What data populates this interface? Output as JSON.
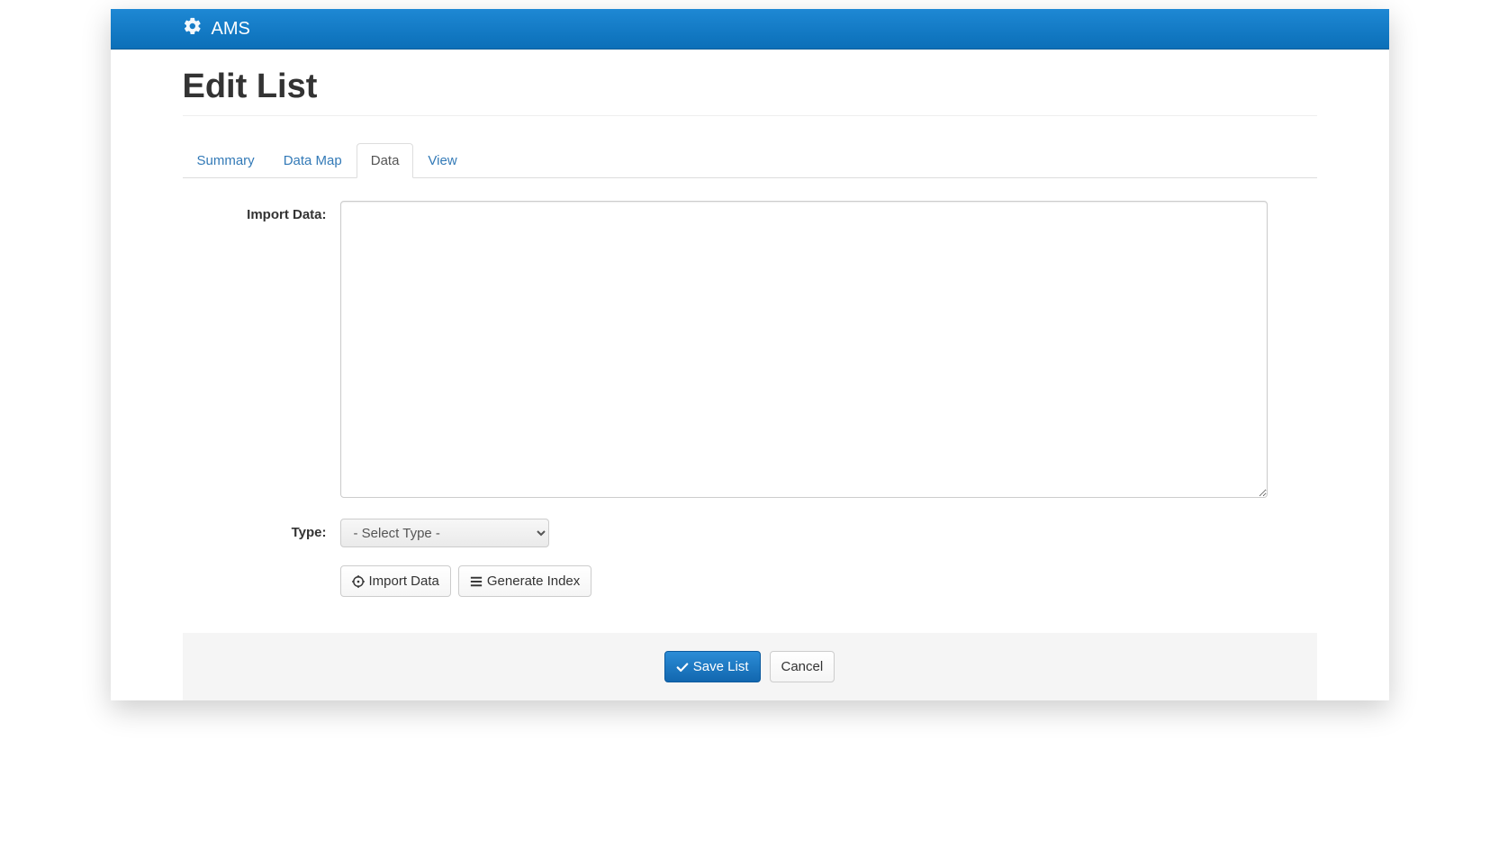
{
  "app": {
    "name": "AMS"
  },
  "page": {
    "title": "Edit List"
  },
  "tabs": [
    {
      "label": "Summary",
      "active": false
    },
    {
      "label": "Data Map",
      "active": false
    },
    {
      "label": "Data",
      "active": true
    },
    {
      "label": "View",
      "active": false
    }
  ],
  "form": {
    "import_data": {
      "label": "Import Data:",
      "value": ""
    },
    "type": {
      "label": "Type:",
      "placeholder": "- Select Type -",
      "value": ""
    },
    "buttons": {
      "import_data": "Import Data",
      "generate_index": "Generate Index"
    }
  },
  "footer": {
    "save": "Save List",
    "cancel": "Cancel"
  }
}
